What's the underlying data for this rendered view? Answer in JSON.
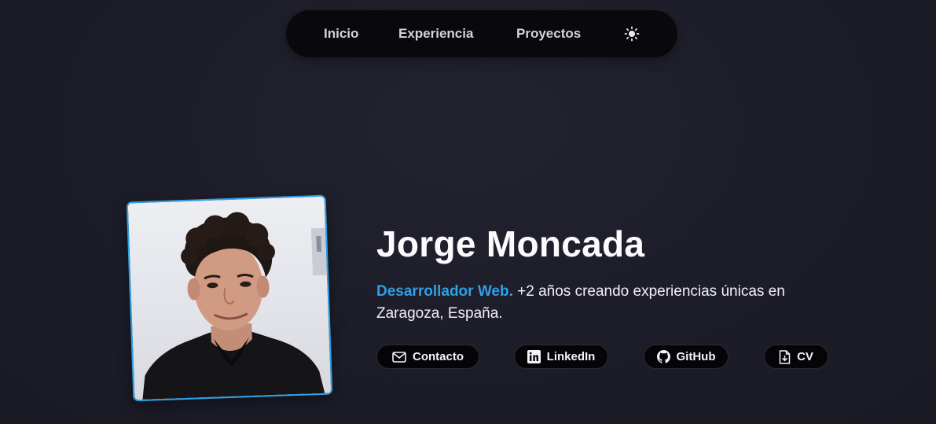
{
  "nav": {
    "items": [
      {
        "label": "Inicio"
      },
      {
        "label": "Experiencia"
      },
      {
        "label": "Proyectos"
      }
    ],
    "theme_icon": "sun-icon"
  },
  "profile": {
    "name": "Jorge Moncada",
    "role": "Desarrollador Web.",
    "summary": " +2 años creando experiencias únicas en Zaragoza, España.",
    "accent_color": "#2f9fe6"
  },
  "links": [
    {
      "label": "Contacto",
      "icon": "mail-icon"
    },
    {
      "label": "LinkedIn",
      "icon": "linkedin-icon"
    },
    {
      "label": "GitHub",
      "icon": "github-icon"
    },
    {
      "label": "CV",
      "icon": "document-download-icon"
    }
  ]
}
